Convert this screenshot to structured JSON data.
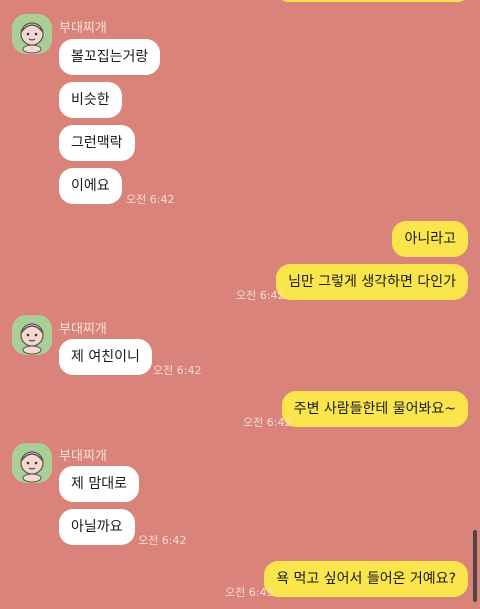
{
  "sender": {
    "name": "부대찌개",
    "avatar_icon": "character-avatar-icon"
  },
  "colors": {
    "background": "#d9837a",
    "incoming": "#ffffff",
    "outgoing": "#fbe54d"
  },
  "messages": [
    {
      "dir": "in",
      "text": "볼꼬집는거랑"
    },
    {
      "dir": "in",
      "text": "비슷한"
    },
    {
      "dir": "in",
      "text": "그런맥락"
    },
    {
      "dir": "in",
      "text": "이에요",
      "time": "오전 6:42"
    },
    {
      "dir": "out",
      "text": "아니라고"
    },
    {
      "dir": "out",
      "text": "님만 그렇게 생각하면 다인가",
      "time": "오전 6:42"
    },
    {
      "dir": "in",
      "text": "제 여친이니",
      "time": "오전 6:42"
    },
    {
      "dir": "out",
      "text": "주변 사람들한테 물어봐요~",
      "time": "오전 6:42"
    },
    {
      "dir": "in",
      "text": "제 맘대로"
    },
    {
      "dir": "in",
      "text": "아닐까요",
      "time": "오전 6:42"
    },
    {
      "dir": "out",
      "text": "욕 먹고 싶어서 들어온 거예요?",
      "time": "오전 6:43"
    }
  ]
}
